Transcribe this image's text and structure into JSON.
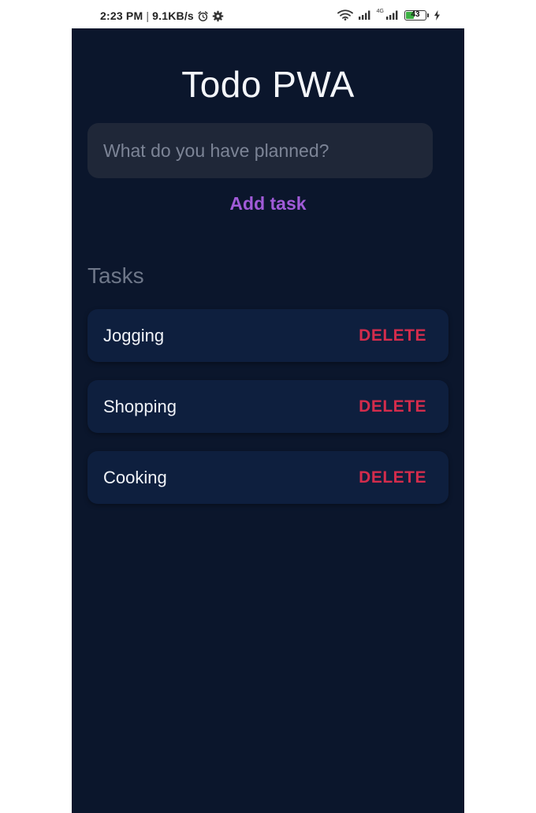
{
  "status_bar": {
    "time": "2:23 PM",
    "separator": "|",
    "network_speed": "9.1KB/s",
    "network_type": "4G",
    "battery_level": "43",
    "battery_fraction": 0.43,
    "icons": [
      "alarm-icon",
      "settings-icon",
      "wifi-icon",
      "signal-icon",
      "signal-4g-icon",
      "battery-icon",
      "charging-icon"
    ]
  },
  "app": {
    "title": "Todo PWA",
    "input": {
      "placeholder": "What do you have planned?",
      "value": ""
    },
    "add_button_label": "Add task",
    "tasks_heading": "Tasks",
    "tasks": [
      {
        "name": "Jogging",
        "delete_label": "DELETE"
      },
      {
        "name": "Shopping",
        "delete_label": "DELETE"
      },
      {
        "name": "Cooking",
        "delete_label": "DELETE"
      }
    ]
  },
  "colors": {
    "background": "#0b162c",
    "card": "#0e1f3e",
    "input": "#1f2738",
    "accent_purple": "#a15bd8",
    "delete_red": "#d32c4c",
    "battery_green": "#3cb043"
  }
}
